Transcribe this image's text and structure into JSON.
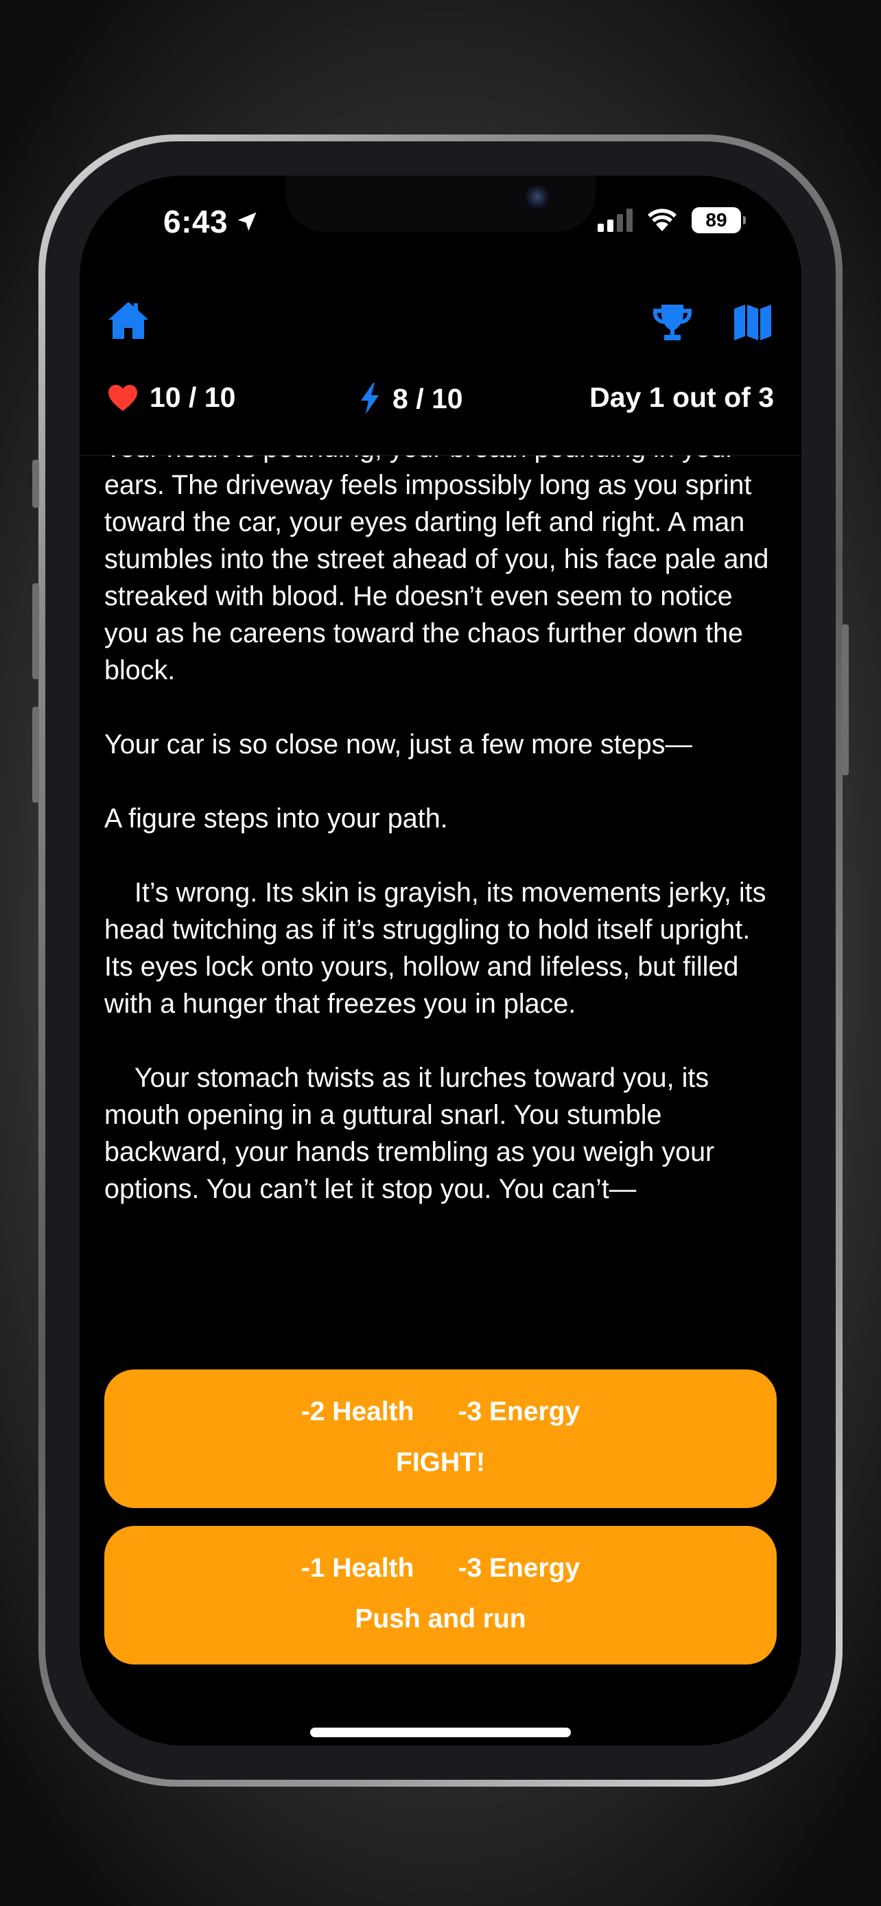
{
  "status_bar": {
    "time": "6:43",
    "battery": "89"
  },
  "toolbar": {
    "home_icon": "house-icon",
    "trophy_icon": "trophy-icon",
    "map_icon": "map-icon",
    "accent": "#1a7cf5"
  },
  "stats": {
    "health": "10 / 10",
    "energy": "8 / 10",
    "day": "Day 1 out of 3",
    "health_color": "#ff3b30",
    "energy_color": "#1a7cf5"
  },
  "story": {
    "text": "Your heart is pounding, your breath pounding in your ears. The driveway feels impossibly long as you sprint toward the car, your eyes darting left and right. A man stumbles into the street ahead of you, his face pale and streaked with blood. He doesn’t even seem to notice you as he careens toward the chaos further down the block.\n\nYour car is so close now, just a few more steps—\n\nA figure steps into your path.\n\n    It’s wrong. Its skin is grayish, its movements jerky, its head twitching as if it’s struggling to hold itself upright. Its eyes lock onto yours, hollow and lifeless, but filled with a hunger that freezes you in place.\n\n    Your stomach twists as it lurches toward you, its mouth opening in a guttural snarl. You stumble backward, your hands trembling as you weigh your options. You can’t let it stop you. You can’t—"
  },
  "choices": [
    {
      "health_cost": "-2 Health",
      "energy_cost": "-3 Energy",
      "label": "FIGHT!"
    },
    {
      "health_cost": "-1 Health",
      "energy_cost": "-3 Energy",
      "label": "Push and run"
    }
  ],
  "colors": {
    "button": "#fe9f0a",
    "background": "#000000"
  }
}
